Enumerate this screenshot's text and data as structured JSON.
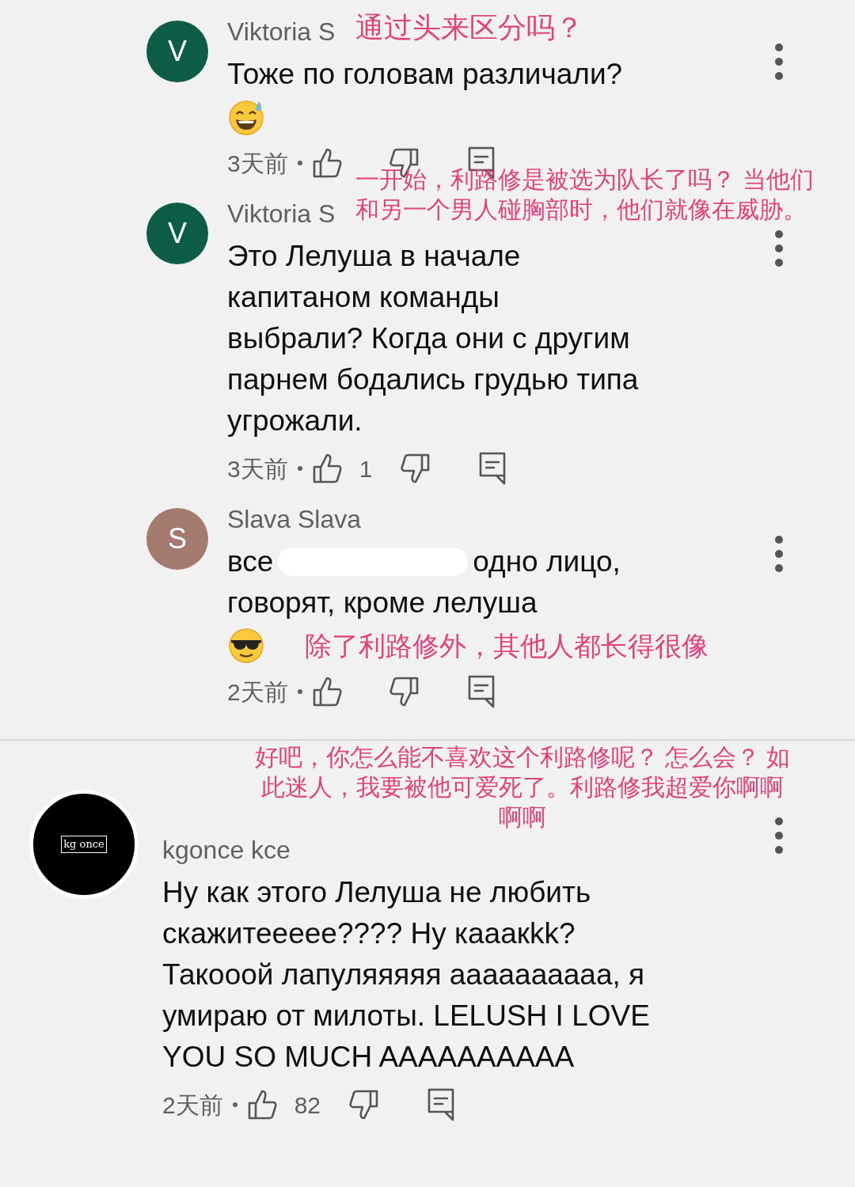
{
  "comments": [
    {
      "kind": "reply",
      "author": "Viktoria S",
      "avatar": {
        "letter": "V",
        "color": "#0d5c47"
      },
      "note": {
        "kind": "name",
        "lines": [
          "通过头来区分吗？"
        ]
      },
      "lines": [
        [
          "Тоже по головам различали?"
        ]
      ],
      "emoji": {
        "kind": "sweat_smile"
      },
      "time": "3天前"
    },
    {
      "kind": "reply",
      "author": "Viktoria S",
      "avatar": {
        "letter": "V",
        "color": "#0d5c47"
      },
      "note": {
        "kind": "name",
        "lines": [
          "一开始，利路修是被选为队长了吗？ 当他们",
          "和另一个男人碰胸部时，他们就像在威胁。"
        ]
      },
      "lines": [
        [
          "Это Лелуша в начале"
        ],
        [
          "капитаном команды"
        ],
        [
          "выбрали? Когда они с другим"
        ],
        [
          "парнем бодались грудью типа"
        ],
        [
          "угрожали."
        ]
      ],
      "time": "3天前",
      "likes": "1"
    },
    {
      "kind": "reply",
      "author": "Slava Slava",
      "avatar": {
        "letter": "S",
        "color": "#a37a6d"
      },
      "note": {
        "kind": "emoji",
        "lines": [
          "除了利路修外，其他人都长得很像"
        ]
      },
      "lines": [
        [
          "все",
          "одно лицо,"
        ],
        [
          "говорят, кроме лелуша"
        ]
      ],
      "emoji": {
        "kind": "sunglasses"
      },
      "time": "2天前"
    },
    {
      "kind": "top",
      "author": "kgonce kce",
      "avatar": {
        "text": "kg once",
        "color": "#000000"
      },
      "note": {
        "kind": "above",
        "lines": [
          "好吧，你怎么能不喜欢这个利路修呢？ 怎么会？ 如",
          "此迷人，我要被他可爱死了。利路修我超爱你啊啊",
          "啊啊"
        ]
      },
      "lines": [
        [
          "Ну как этого Лелуша не любить"
        ],
        [
          "скажитеееее???? Ну кааакkk?"
        ],
        [
          "Такооой лапуляяяяя аааааааааа, я"
        ],
        [
          "умираю от милоты. LELUSH I LOVE"
        ],
        [
          "YOU SO MUCH AAAAAAAAAA"
        ]
      ],
      "time": "2天前",
      "likes": "82"
    }
  ]
}
